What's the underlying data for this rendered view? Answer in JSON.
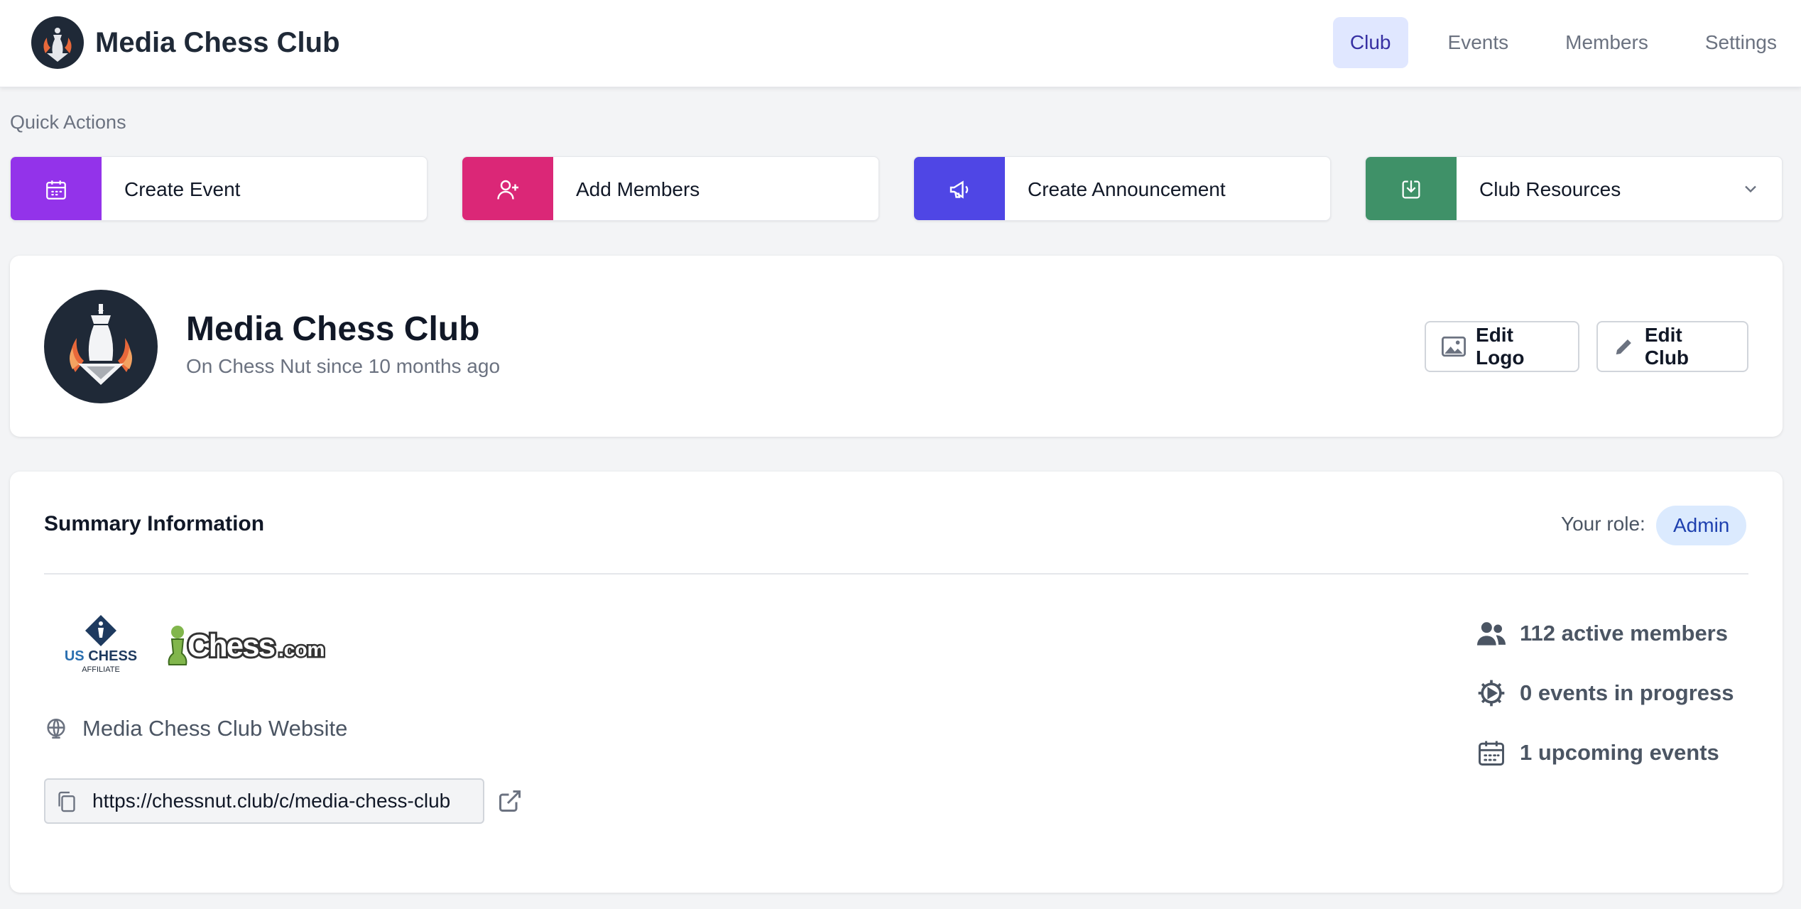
{
  "header": {
    "club_name": "Media Chess Club",
    "nav": [
      {
        "label": "Club",
        "active": true
      },
      {
        "label": "Events",
        "active": false
      },
      {
        "label": "Members",
        "active": false
      },
      {
        "label": "Settings",
        "active": false
      }
    ]
  },
  "quick_actions": {
    "title": "Quick Actions",
    "items": [
      {
        "label": "Create Event",
        "icon": "calendar-icon",
        "color": "#9333ea"
      },
      {
        "label": "Add Members",
        "icon": "user-plus-icon",
        "color": "#db2777"
      },
      {
        "label": "Create Announcement",
        "icon": "megaphone-icon",
        "color": "#4f46e5"
      },
      {
        "label": "Club Resources",
        "icon": "download-icon",
        "color": "#3f9168"
      }
    ]
  },
  "club": {
    "name": "Media Chess Club",
    "since": "On Chess Nut since 10 months ago",
    "edit_logo": "Edit Logo",
    "edit_club": "Edit Club"
  },
  "summary": {
    "title": "Summary Information",
    "role_label": "Your role:",
    "role": "Admin",
    "uschess_logo_text": "US CHESS",
    "uschess_logo_sub": "AFFILIATE",
    "chesscom_logo_text": "Chess.com",
    "website_label": "Media Chess Club Website",
    "url": "https://chessnut.club/c/media-chess-club",
    "stats": [
      {
        "icon": "users-icon",
        "text": "112 active members"
      },
      {
        "icon": "progress-gear-icon",
        "text": "0 events in progress"
      },
      {
        "icon": "calendar-icon",
        "text": "1 upcoming events"
      }
    ]
  }
}
